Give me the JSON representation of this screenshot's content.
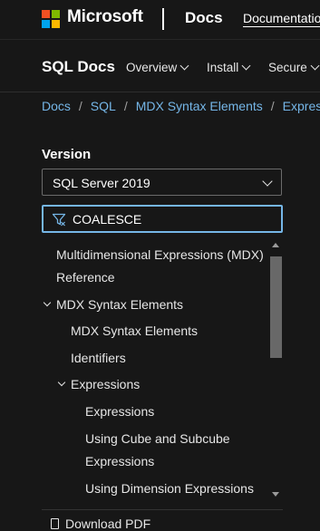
{
  "header": {
    "brand": "Microsoft",
    "docs_link": "Docs",
    "nav_item": "Documentation"
  },
  "subheader": {
    "product_title": "SQL Docs",
    "menu": [
      "Overview",
      "Install",
      "Secure"
    ]
  },
  "breadcrumb": [
    "Docs",
    "SQL",
    "MDX Syntax Elements",
    "Express"
  ],
  "version": {
    "label": "Version",
    "selected": "SQL Server 2019"
  },
  "filter": {
    "value": "COALESCE"
  },
  "toc": {
    "items": [
      {
        "label": "Multidimensional Expressions (MDX)"
      },
      {
        "label": "Reference"
      },
      {
        "label": "MDX Syntax Elements"
      },
      {
        "label": "MDX Syntax Elements"
      },
      {
        "label": "Identifiers"
      },
      {
        "label": "Expressions"
      },
      {
        "label": "Expressions"
      },
      {
        "label": "Using Cube and Subcube"
      },
      {
        "label": "Expressions"
      },
      {
        "label": "Using Dimension Expressions"
      }
    ]
  },
  "footer": {
    "download_pdf": "Download PDF"
  },
  "colors": {
    "background": "#171717",
    "link": "#75b6e7",
    "focus_border": "#75b6e7",
    "logo_red": "#f25022",
    "logo_green": "#7fba00",
    "logo_blue": "#00a4ef",
    "logo_yellow": "#ffb900"
  },
  "icons": {
    "logo": "microsoft-logo",
    "menu_expand": "chevron-down-icon",
    "select_expand": "chevron-down-icon",
    "filter": "filter-icon",
    "tree_expanded": "chevron-down-icon",
    "scroll_up": "arrow-up-icon",
    "scroll_down": "arrow-down-icon",
    "pdf": "document-icon"
  }
}
